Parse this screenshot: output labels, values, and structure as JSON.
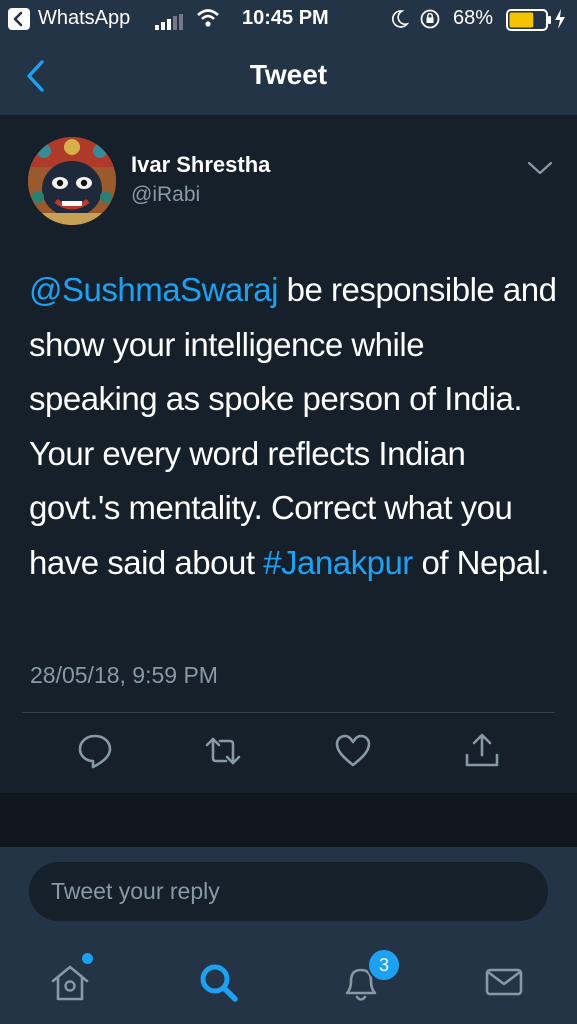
{
  "status_bar": {
    "back_app": "WhatsApp",
    "time": "10:45 PM",
    "battery": "68%",
    "battery_level": 0.68,
    "icons": [
      "back-arrow-icon",
      "signal-icon",
      "wifi-icon",
      "moon-icon",
      "orientation-lock-icon",
      "battery-icon",
      "charging-icon"
    ]
  },
  "nav": {
    "title": "Tweet",
    "back_icon": "back-chevron-icon"
  },
  "tweet": {
    "author_name": "Ivar Shrestha",
    "author_handle": "@iRabi",
    "mention": "@SushmaSwaraj",
    "text_part1": " be responsible and show your intelligence while speaking as spoke person of India. Your every word reflects Indian govt.'s mentality. Correct what you have said about ",
    "hashtag": "#Janakpur",
    "text_part2": " of Nepal.",
    "timestamp": "28/05/18, 9:59 PM",
    "actions": [
      "reply-icon",
      "retweet-icon",
      "like-icon",
      "share-icon"
    ]
  },
  "reply": {
    "placeholder": "Tweet your reply"
  },
  "tabs": {
    "items": [
      "home-icon",
      "search-icon",
      "notifications-icon",
      "messages-icon"
    ],
    "notification_count": "3"
  },
  "colors": {
    "background": "#15202b",
    "bar": "#243447",
    "accent": "#1da1f2",
    "muted": "#8899a6",
    "battery": "#f5c400"
  }
}
